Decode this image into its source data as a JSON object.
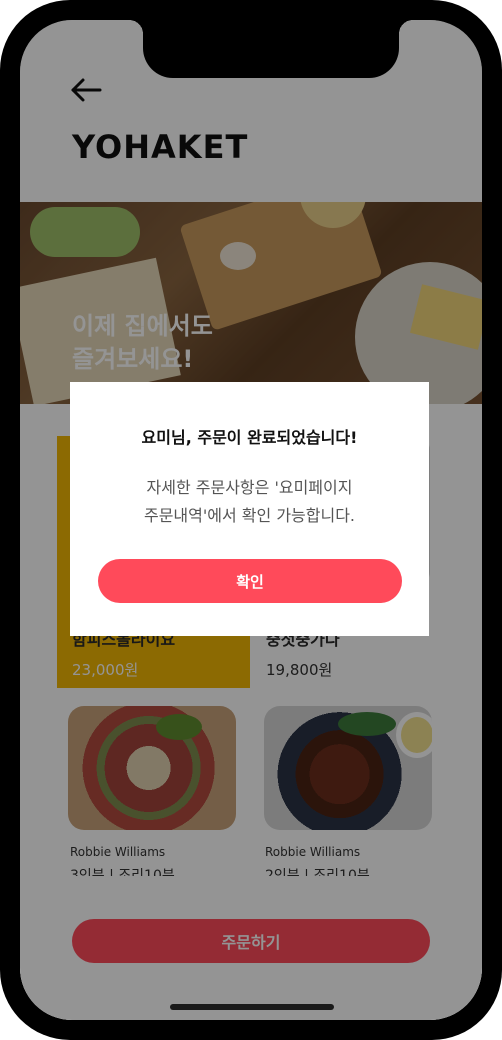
{
  "app": {
    "title": "YOHAKET"
  },
  "hero": {
    "line1": "이제 집에서도",
    "line2": "즐겨보세요!"
  },
  "products": [
    {
      "name": "함피스볼라이요",
      "price": "23,000원"
    },
    {
      "name": "중첫중가다",
      "price": "19,800원"
    }
  ],
  "recipes": [
    {
      "author": "Robbie Williams",
      "serving": "3인분 | 조리10분"
    },
    {
      "author": "Robbie Williams",
      "serving": "2인분 | 조리10분"
    }
  ],
  "bottom": {
    "order_label": "주문하기"
  },
  "modal": {
    "title": "요미님, 주문이 완료되었습니다!",
    "body_line1": "자세한 주문사항은 '요미페이지",
    "body_line2": "주문내역'에서 확인 가능합니다.",
    "confirm_label": "확인"
  },
  "colors": {
    "accent": "#ff4a5a",
    "card_yellow": "#f2b705",
    "overlay": "rgba(0,0,0,0.42)"
  },
  "icons": {
    "back": "arrow-left-icon"
  }
}
